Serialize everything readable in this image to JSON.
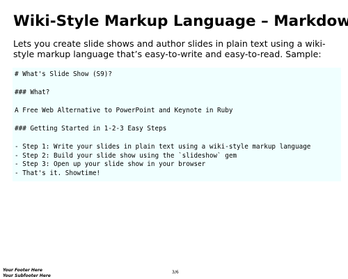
{
  "slide": {
    "title": "Wiki-Style Markup Language – Markdown",
    "intro": "Lets you create slide shows and author slides in plain text using a wiki-style markup language that’s easy-to-write and easy-to-read. Sample:",
    "code": {
      "lines": [
        "# What's Slide Show (S9)?",
        "### What?",
        "A Free Web Alternative to PowerPoint and Keynote in Ruby",
        "### Getting Started in 1-2-3 Easy Steps",
        "- Step 1: Write your slides in plain text using a wiki-style markup language",
        "- Step 2: Build your slide show using the `slideshow` gem",
        "- Step 3: Open up your slide show in your browser",
        "- That's it. Showtime!"
      ]
    }
  },
  "footer": {
    "line1": "Your Footer Here",
    "line2": "Your Subfooter Here"
  },
  "page_counter": "3/6",
  "colors": {
    "code_background": "#f0ffff",
    "text": "#000000",
    "page_background": "#ffffff"
  }
}
